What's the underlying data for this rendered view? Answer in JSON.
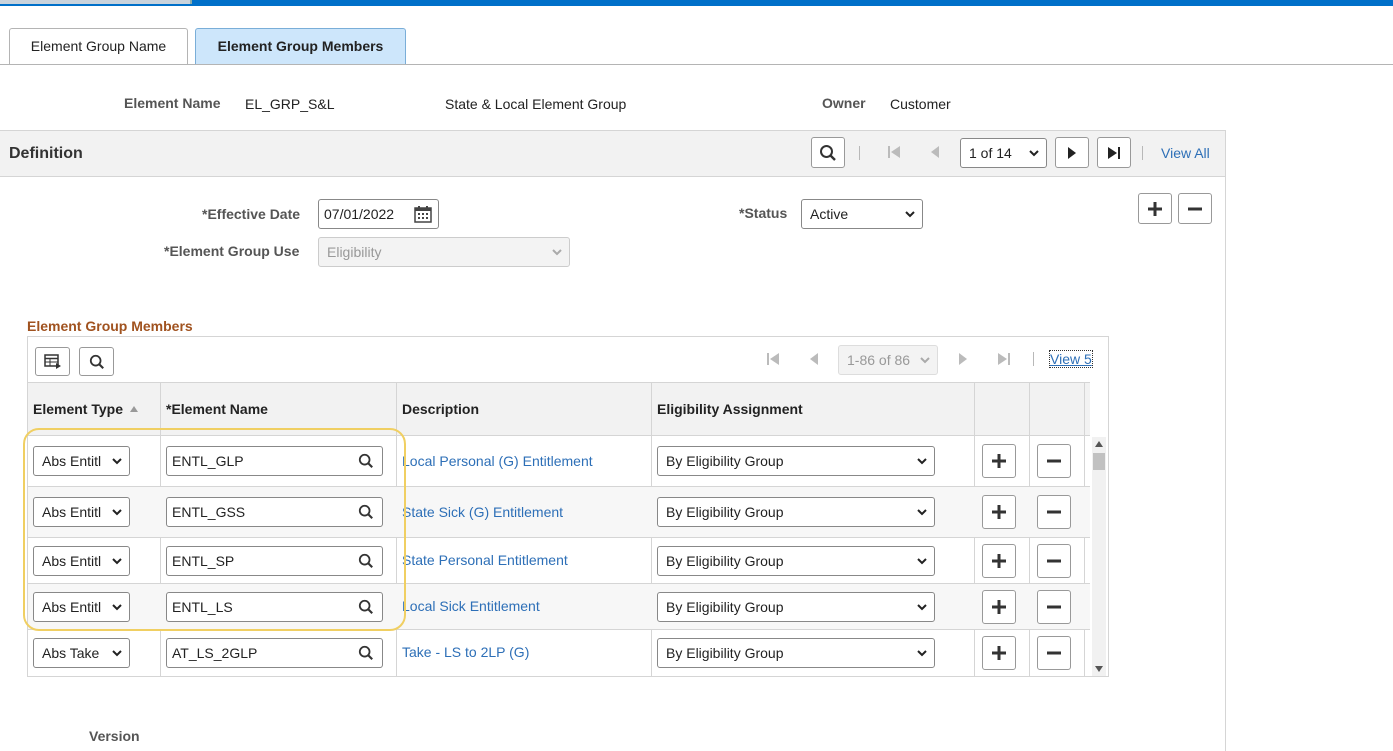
{
  "tabs": [
    {
      "label": "Element Group Name"
    },
    {
      "label": "Element Group Members"
    }
  ],
  "header": {
    "element_name_label": "Element Name",
    "element_name_value": "EL_GRP_S&L",
    "element_description": "State & Local Element Group",
    "owner_label": "Owner",
    "owner_value": "Customer"
  },
  "definition": {
    "title": "Definition",
    "pagination": "1 of 14",
    "view_all": "View All",
    "effective_date_label": "*Effective Date",
    "effective_date_value": "07/01/2022",
    "element_group_use_label": "*Element Group Use",
    "element_group_use_value": "Eligibility",
    "status_label": "*Status",
    "status_value": "Active"
  },
  "members": {
    "title": "Element Group Members",
    "pagination": "1-86 of 86",
    "view_link": "View 5",
    "columns": [
      "Element Type",
      "*Element Name",
      "Description",
      "Eligibility Assignment"
    ],
    "rows": [
      {
        "type": "Abs Entitl",
        "name": "ENTL_GLP",
        "description": "Local Personal (G) Entitlement",
        "assignment": "By Eligibility Group"
      },
      {
        "type": "Abs Entitl",
        "name": "ENTL_GSS",
        "description": "State Sick (G) Entitlement",
        "assignment": "By Eligibility Group"
      },
      {
        "type": "Abs Entitl",
        "name": "ENTL_SP",
        "description": "State Personal Entitlement",
        "assignment": "By Eligibility Group"
      },
      {
        "type": "Abs Entitl",
        "name": "ENTL_LS",
        "description": "Local Sick Entitlement",
        "assignment": "By Eligibility Group"
      },
      {
        "type": "Abs Take",
        "name": "AT_LS_2GLP",
        "description": "Take - LS to 2LP (G)",
        "assignment": "By Eligibility Group"
      }
    ]
  },
  "footer": {
    "version_label": "Version"
  },
  "colors": {
    "accent": "#0070c9",
    "link": "#2d6fb7",
    "section_title": "#a0521f",
    "highlight": "#f0cf62"
  }
}
